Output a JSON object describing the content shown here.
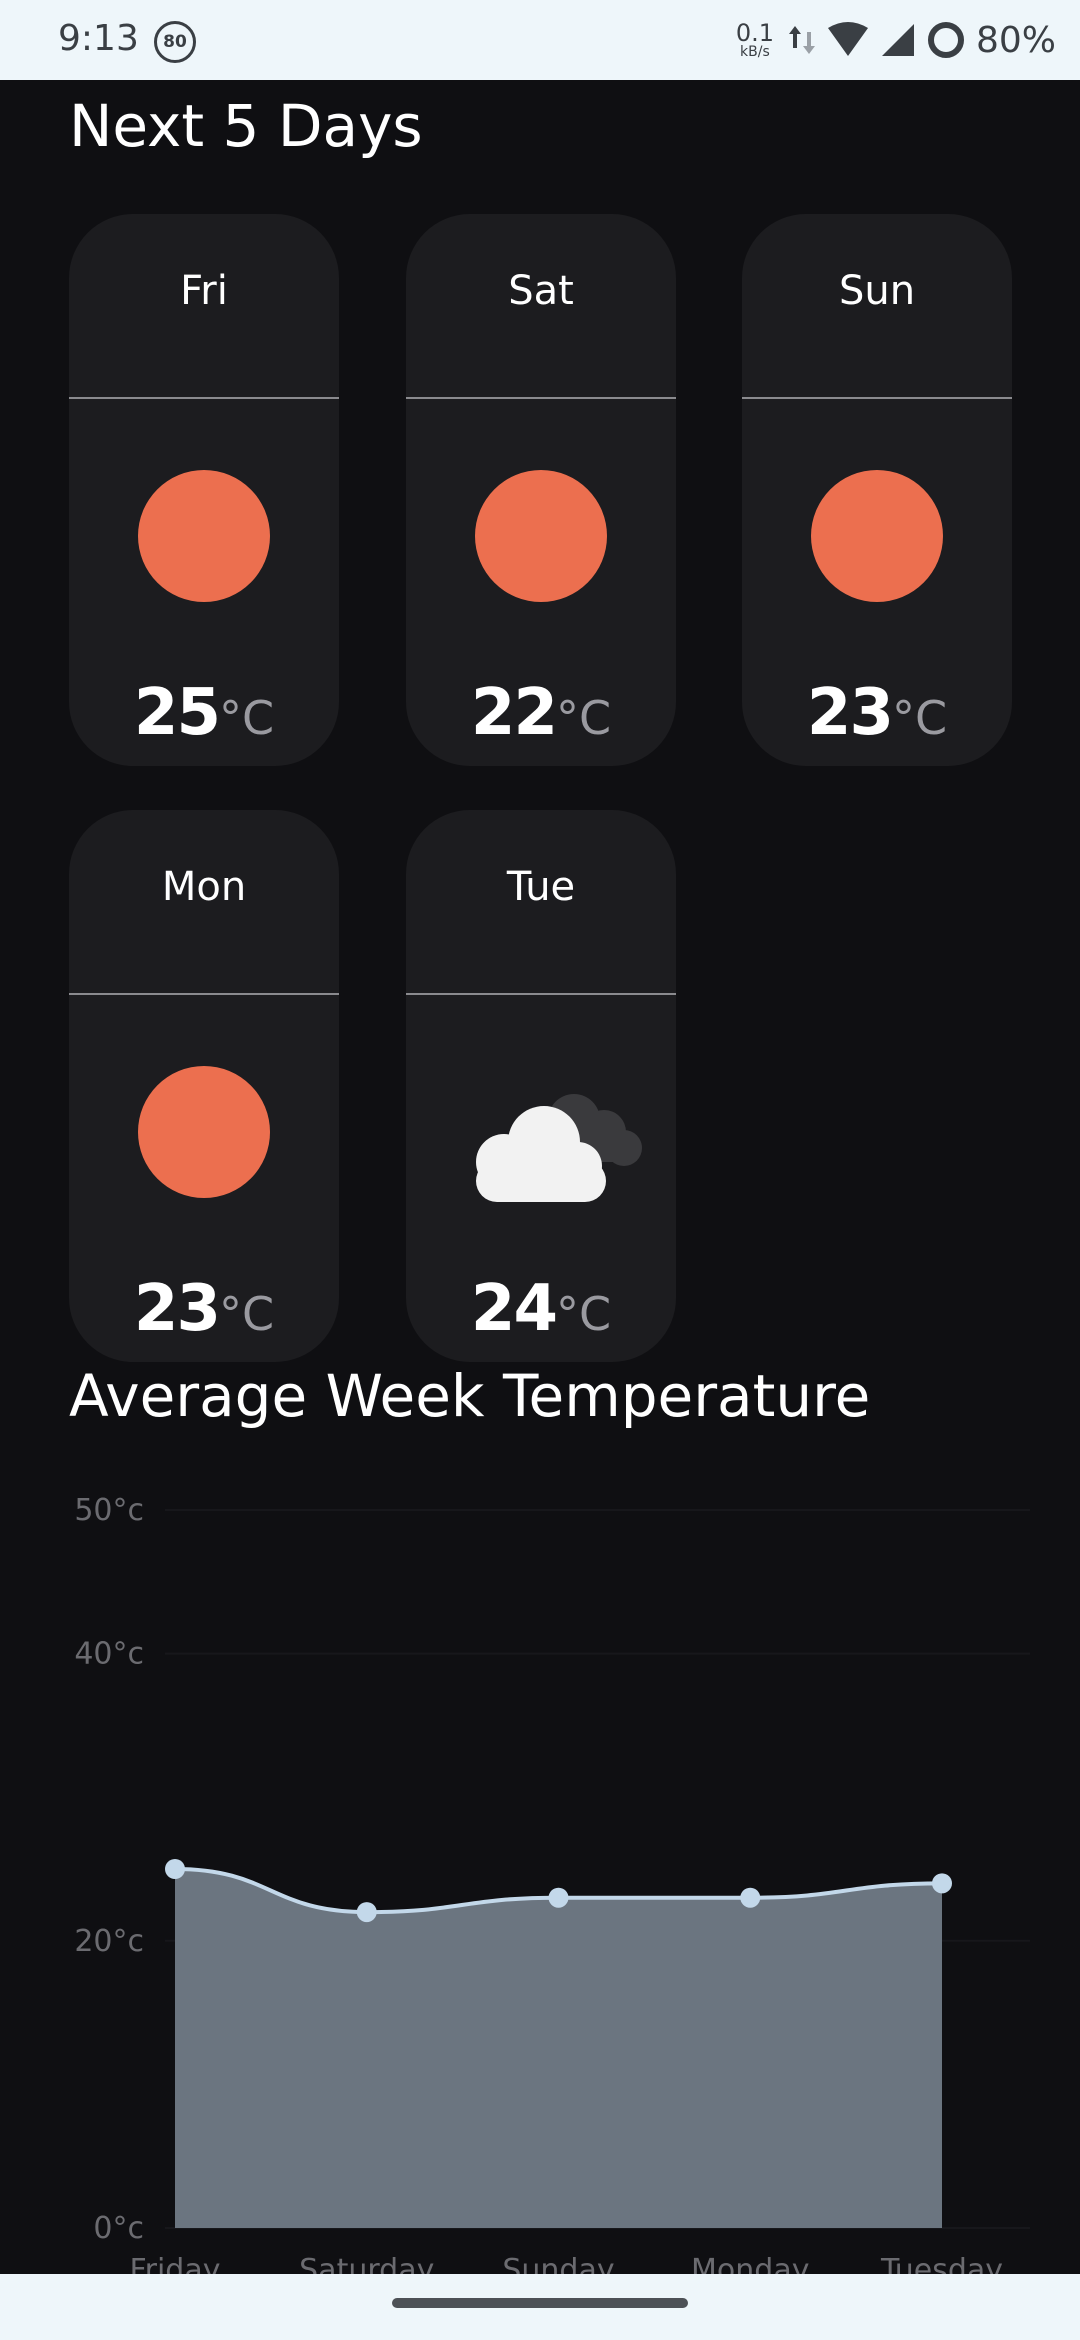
{
  "status_bar": {
    "time": "9:13",
    "badge": "80",
    "net_speed_value": "0.1",
    "net_speed_unit": "kB/s",
    "battery": "80%"
  },
  "forecast": {
    "title": "Next 5 Days",
    "unit": "°C",
    "days": [
      {
        "day": "Fri",
        "temp": "25",
        "icon": "sun-icon"
      },
      {
        "day": "Sat",
        "temp": "22",
        "icon": "sun-icon"
      },
      {
        "day": "Sun",
        "temp": "23",
        "icon": "sun-icon"
      },
      {
        "day": "Mon",
        "temp": "23",
        "icon": "sun-icon"
      },
      {
        "day": "Tue",
        "temp": "24",
        "icon": "cloud-icon"
      }
    ]
  },
  "average_section": {
    "title": "Average Week Temperature"
  },
  "chart_data": {
    "type": "area",
    "categories": [
      "Friday",
      "Saturday",
      "Sunday",
      "Monday",
      "Tuesday"
    ],
    "values": [
      25,
      22,
      23,
      23,
      24
    ],
    "y_ticks": [
      "0°c",
      "20°c",
      "40°c",
      "50°c"
    ],
    "y_tick_values": [
      0,
      20,
      40,
      50
    ],
    "ylim": [
      0,
      50
    ],
    "colors": {
      "line": "#c3d8ea",
      "fill": "#6b7580",
      "point": "#c3d8ea"
    }
  }
}
